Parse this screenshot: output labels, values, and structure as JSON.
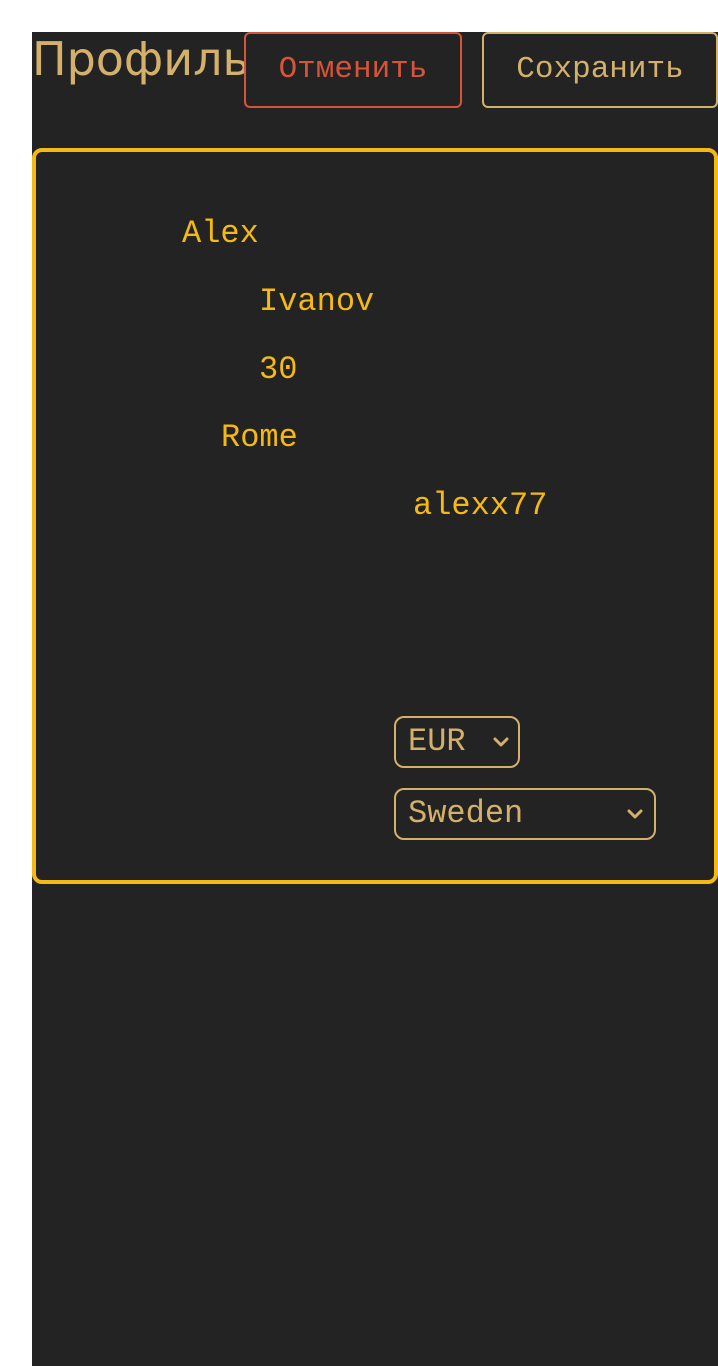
{
  "header": {
    "title": "Профиль",
    "cancel_label": "Отменить",
    "save_label": "Сохранить"
  },
  "profile": {
    "first_name": "Alex",
    "last_name": "Ivanov",
    "age": "30",
    "city": "Rome",
    "username": "alexx77"
  },
  "selects": {
    "currency": {
      "selected": "EUR",
      "icon": "chevron-down-icon"
    },
    "country": {
      "selected": "Sweden",
      "icon": "chevron-down-icon"
    }
  },
  "colors": {
    "background": "#232323",
    "accent": "#f5b914",
    "muted_gold": "#d4b16a",
    "danger": "#d6543a"
  }
}
